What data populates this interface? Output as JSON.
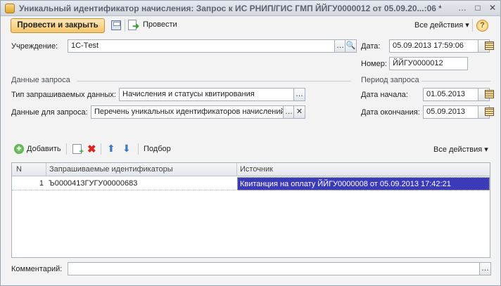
{
  "window": {
    "title": "Уникальный идентификатор начисления: Запрос к ИС РНИП/ГИС ГМП ЙЙГУ0000012 от 05.09.20...:06 *",
    "buttons": [
      "…",
      "□",
      "✕"
    ]
  },
  "toolbar": {
    "post_close_label": "Провести и закрыть",
    "post_label": "Провести",
    "all_actions_label": "Все действия",
    "help_label": "?"
  },
  "header": {
    "institution_label": "Учреждение:",
    "institution_value": "1С-Тest",
    "date_label": "Дата:",
    "date_value": "05.09.2013 17:59:06",
    "number_label": "Номер:",
    "number_value": "ЙЙГУ0000012"
  },
  "request_data": {
    "section_title": "Данные запроса",
    "type_label": "Тип запрашиваемых данных:",
    "type_value": "Начисления и статусы квитирования",
    "data_label": "Данные для запроса:",
    "data_value": "Перечень уникальных идентификаторов начислений"
  },
  "period": {
    "section_title": "Период запроса",
    "start_label": "Дата начала:",
    "start_value": "01.05.2013",
    "end_label": "Дата окончания:",
    "end_value": "05.09.2013"
  },
  "grid_toolbar": {
    "add_label": "Добавить",
    "pick_label": "Подбор",
    "all_actions_label": "Все действия"
  },
  "grid": {
    "columns": [
      "N",
      "Запрашиваемые идентификаторы",
      "Источник"
    ],
    "rows": [
      {
        "n": "1",
        "id": "Ъ0000413ГУГУ00000683",
        "source": "Квитанция на оплату ЙЙГУ0000008 от 05.09.2013 17:42:21"
      }
    ]
  },
  "comment": {
    "label": "Комментарий:",
    "value": ""
  }
}
